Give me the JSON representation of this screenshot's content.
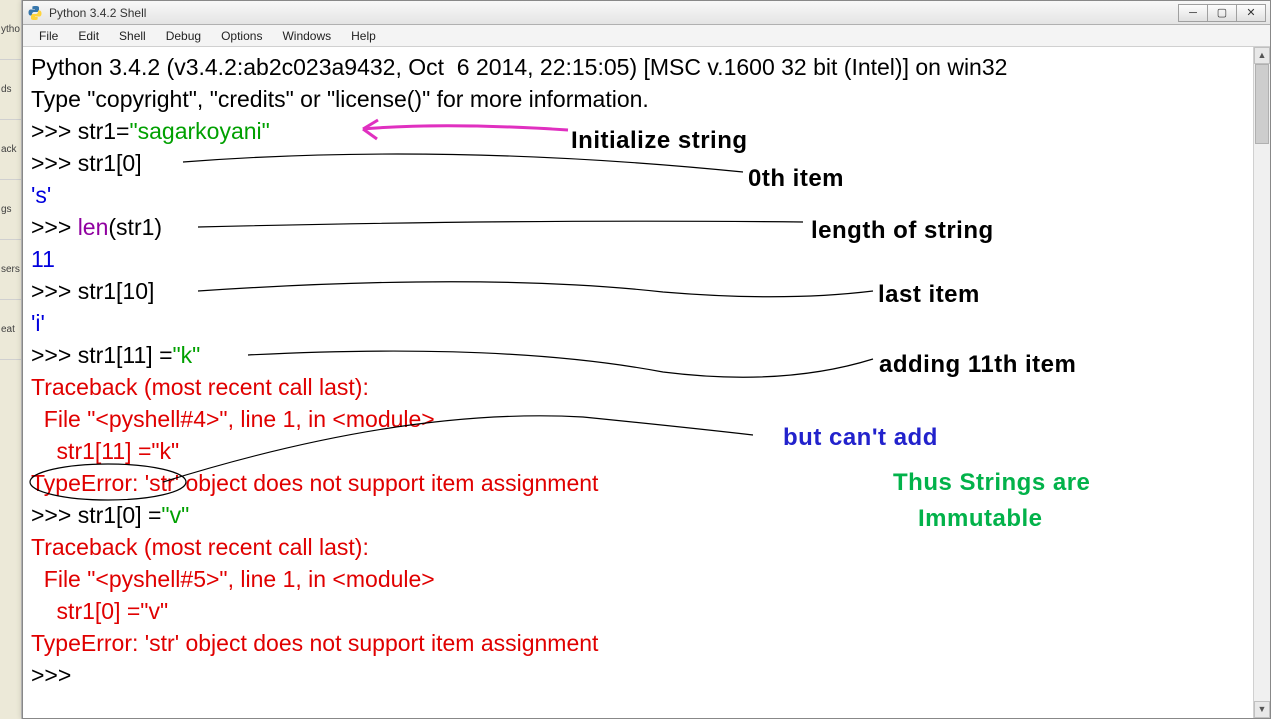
{
  "window": {
    "title": "Python 3.4.2 Shell"
  },
  "menu": {
    "file": "File",
    "edit": "Edit",
    "shell": "Shell",
    "debug": "Debug",
    "options": "Options",
    "windows": "Windows",
    "help": "Help"
  },
  "shell": {
    "banner1": "Python 3.4.2 (v3.4.2:ab2c023a9432, Oct  6 2014, 22:15:05) [MSC v.1600 32 bit (Intel)] on win32",
    "banner2": "Type \"copyright\", \"credits\" or \"license()\" for more information.",
    "prompt": ">>> ",
    "l1_pre": "str1=",
    "l1_str": "\"sagarkoyani\"",
    "l2": "str1[0]",
    "o2": "'s'",
    "l3_fn": "len",
    "l3_arg": "(str1)",
    "o3": "11",
    "l4": "str1[10]",
    "o4": "'i'",
    "l5_pre": "str1[11] =",
    "l5_str": "\"k\"",
    "tb": "Traceback (most recent call last):",
    "tb1_file": "  File \"<pyshell#4>\", line 1, in <module>",
    "tb1_code": "    str1[11] =\"k\"",
    "tb1_err": "TypeError: 'str' object does not support item assignment",
    "l6_pre": "str1[0] =",
    "l6_str": "\"v\"",
    "tb2_file": "  File \"<pyshell#5>\", line 1, in <module>",
    "tb2_code": "    str1[0] =\"v\"",
    "tb2_err": "TypeError: 'str' object does not support item assignment"
  },
  "annot": {
    "init": "Initialize string",
    "item0": "0th  item",
    "len": "length of string",
    "last": "last item",
    "add11": "adding 11th item",
    "cant": "but can't add",
    "immut1": "Thus Strings are",
    "immut2": "Immutable"
  },
  "left_tabs": [
    "ytho",
    "ds",
    "ack",
    "gs",
    "sers",
    "eat"
  ]
}
